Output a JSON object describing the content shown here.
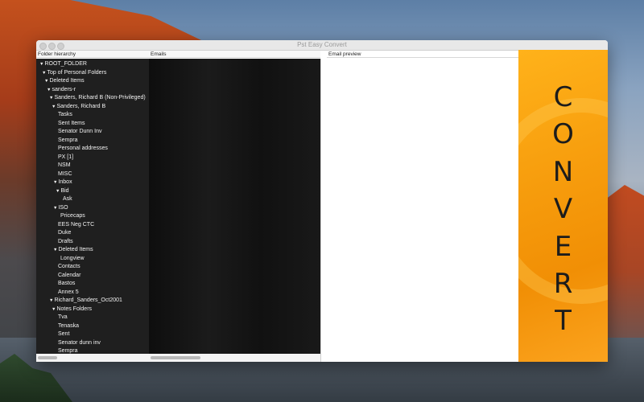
{
  "window": {
    "title": "Pst Easy Convert"
  },
  "headers": {
    "folder_hierarchy": "Folder hierarchy",
    "emails": "Emails",
    "email_preview": "Email preview"
  },
  "tree": [
    {
      "label": "ROOT_FOLDER",
      "expanded": true
    },
    {
      "label": "Top of Personal Folders",
      "expanded": true
    },
    {
      "label": "Deleted Items",
      "expanded": true
    },
    {
      "label": "sanders-r",
      "expanded": true
    },
    {
      "label": "Sanders, Richard B (Non-Privileged)",
      "expanded": true
    },
    {
      "label": "Sanders, Richard B",
      "expanded": true
    },
    {
      "label": "Tasks"
    },
    {
      "label": "Sent Items"
    },
    {
      "label": "Senator Dunn Inv"
    },
    {
      "label": "Sempra"
    },
    {
      "label": "Personal addresses"
    },
    {
      "label": "PX [1]"
    },
    {
      "label": "NSM"
    },
    {
      "label": "MISC"
    },
    {
      "label": "Inbox",
      "expanded": true
    },
    {
      "label": "Bid",
      "expanded": true
    },
    {
      "label": "Ask"
    },
    {
      "label": "ISO",
      "expanded": true
    },
    {
      "label": "Pricecaps"
    },
    {
      "label": "EES Neg CTC"
    },
    {
      "label": "Duke"
    },
    {
      "label": "Drafts"
    },
    {
      "label": "Deleted Items",
      "expanded": true
    },
    {
      "label": "Longview"
    },
    {
      "label": "Contacts"
    },
    {
      "label": "Calendar"
    },
    {
      "label": "Bastos"
    },
    {
      "label": "Annex 5"
    },
    {
      "label": "Richard_Sanders_Oct2001",
      "expanded": true
    },
    {
      "label": "Notes Folders",
      "expanded": true
    },
    {
      "label": "Tva"
    },
    {
      "label": "Tenaska"
    },
    {
      "label": "Sent"
    },
    {
      "label": "Senator dunn inv"
    },
    {
      "label": "Sempra"
    }
  ],
  "expand_glyph": "▼",
  "convert_banner": {
    "letters": [
      "C",
      "O",
      "N",
      "V",
      "E",
      "R",
      "T"
    ]
  },
  "colors": {
    "accent": "#f79d0d",
    "tree_bg": "#1f1f1f",
    "tree_text": "#f2f2f2"
  }
}
